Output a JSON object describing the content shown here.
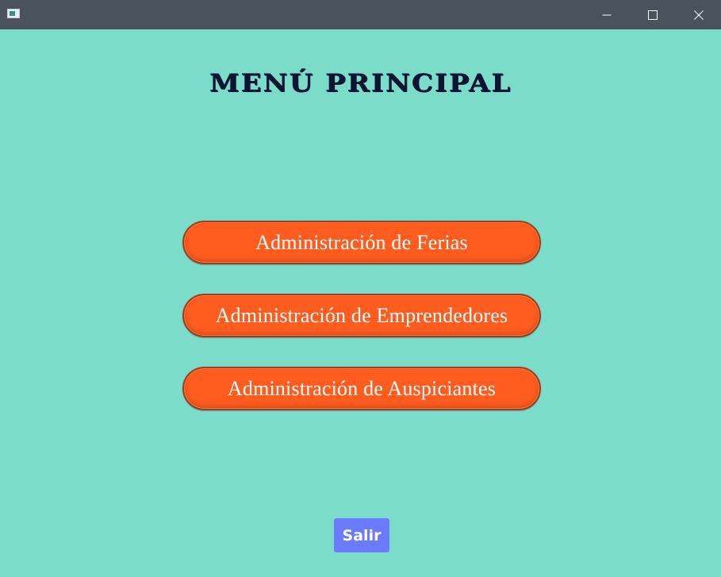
{
  "window": {
    "minimize_icon": "minimize-icon",
    "maximize_icon": "maximize-icon",
    "close_icon": "close-icon",
    "app_icon": "app-window-icon"
  },
  "main": {
    "title": "MENÚ PRINCIPAL",
    "buttons": [
      {
        "label": "Administración de Ferias"
      },
      {
        "label": "Administración de Emprendedores"
      },
      {
        "label": "Administración de Auspiciantes"
      }
    ],
    "exit_label": "Salir"
  },
  "colors": {
    "background": "#7adcc9",
    "titlebar": "#4a535c",
    "menu_button": "#ff5c1f",
    "exit_button": "#6a7bff",
    "title_text": "#0d1533"
  }
}
